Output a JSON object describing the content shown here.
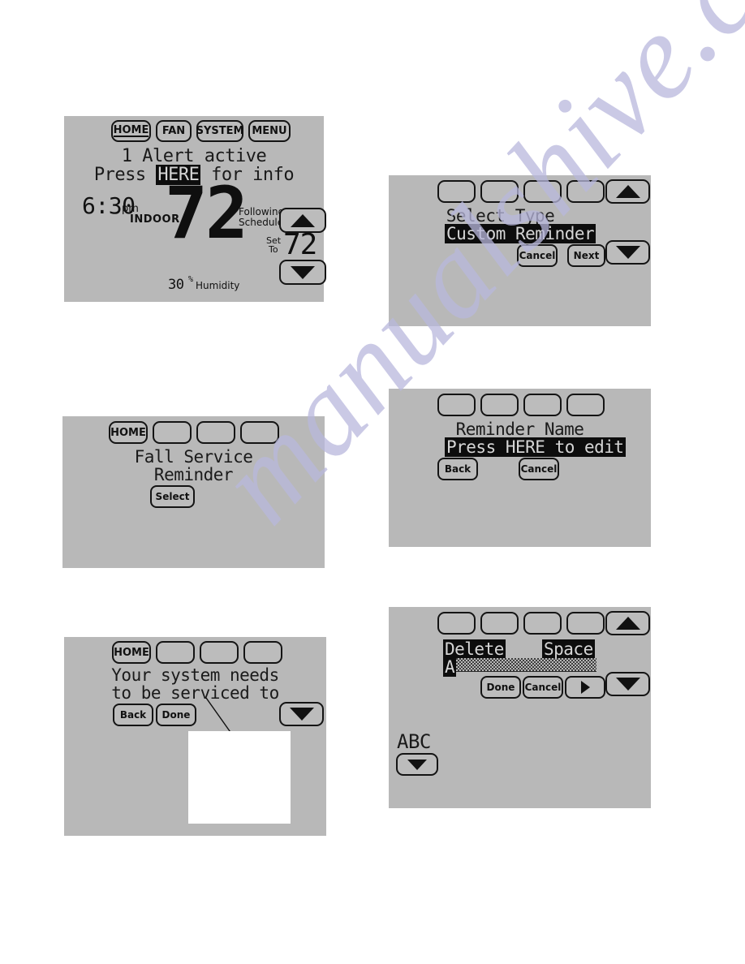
{
  "watermark": {
    "lines": [
      "manualshive.com"
    ]
  },
  "panels": {
    "home_screen": {
      "tabs": [
        "HOME",
        "FAN",
        "SYSTEM",
        "MENU"
      ],
      "alert_line1": "1 Alert active",
      "alert_line2_before": "Press ",
      "alert_line2_highlight": "HERE",
      "alert_line2_after": " for info",
      "indoor_label": "INDOOR",
      "indoor_temp": "72",
      "degree": "°",
      "time": "6:30",
      "ampm": "pm",
      "humidity_value": "30",
      "humidity_percent": "%",
      "humidity_label": "Humidity",
      "status_line1": "Following",
      "status_line2": "Schedule",
      "setto_line1": "Set",
      "setto_line2": "To",
      "set_temp": "72",
      "set_degree": "°",
      "up_icon": "triangle-up-icon",
      "down_icon": "triangle-down-icon"
    },
    "select_type": {
      "tabs": [
        "",
        "",
        "",
        ""
      ],
      "title": "Select Type",
      "selected_value": "Custom Reminder",
      "cancel_label": "Cancel",
      "next_label": "Next",
      "up_icon": "triangle-up-icon",
      "down_icon": "triangle-down-icon"
    },
    "fall_service_reminder": {
      "tabs": [
        "HOME",
        "",
        "",
        ""
      ],
      "line1": "Fall Service",
      "line2": "Reminder",
      "select_label": "Select"
    },
    "reminder_name": {
      "tabs": [
        "",
        "",
        "",
        ""
      ],
      "title": "Reminder Name",
      "edit_prompt": "Press HERE to edit",
      "back_label": "Back",
      "cancel_label": "Cancel"
    },
    "system_needs_service": {
      "tabs": [
        "HOME",
        "",
        "",
        ""
      ],
      "line1": "Your system needs",
      "line2": "to be serviced to",
      "back_label": "Back",
      "done_label": "Done",
      "down_icon": "triangle-down-icon",
      "callout_note": ""
    },
    "text_editor": {
      "tabs": [
        "",
        "",
        "",
        ""
      ],
      "delete_label": "Delete",
      "space_label": "Space",
      "current_char": "A",
      "done_label": "Done",
      "cancel_label": "Cancel",
      "next_arrow_icon": "triangle-right-icon",
      "up_icon": "triangle-up-icon",
      "down_icon": "triangle-down-icon",
      "case_label": "ABC",
      "case_down_icon": "triangle-down-icon"
    }
  },
  "colors": {
    "screen_bg": "#b8b8b8",
    "ink": "#141414",
    "page_bg": "#ffffff",
    "watermark": "#b9b8dd"
  }
}
